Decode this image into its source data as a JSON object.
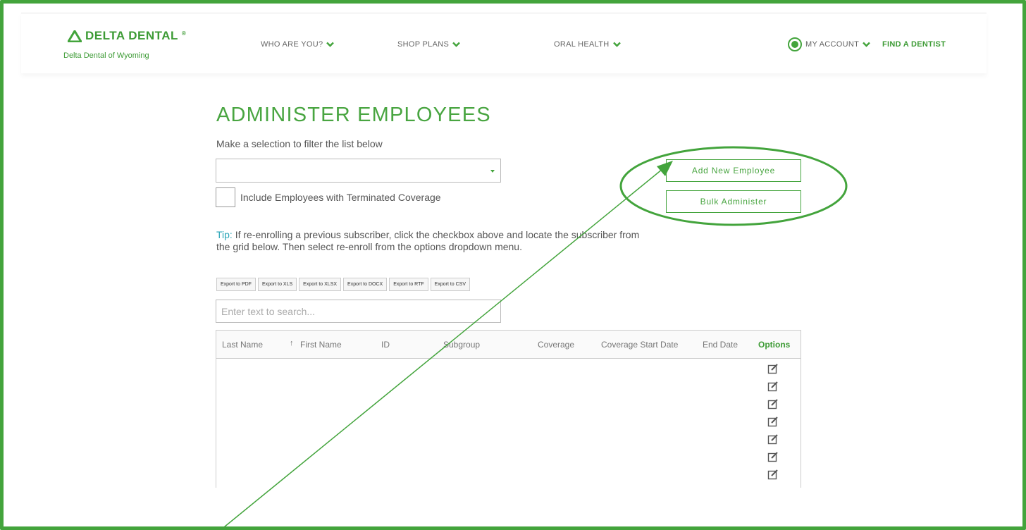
{
  "header": {
    "brand": "DELTA DENTAL",
    "brand_mark": "®",
    "brand_subtitle": "Delta Dental of Wyoming",
    "nav": [
      {
        "label": "WHO ARE YOU?"
      },
      {
        "label": "SHOP PLANS"
      },
      {
        "label": "ORAL HEALTH"
      }
    ],
    "account_label": "MY ACCOUNT",
    "find_dentist": "FIND A DENTIST"
  },
  "page": {
    "title": "ADMINISTER EMPLOYEES",
    "filter_label": "Make a selection to filter the list below",
    "filter_value": "",
    "terminated_label": "Include Employees with Terminated Coverage",
    "add_button": "Add New Employee",
    "bulk_button": "Bulk Administer",
    "tip_word": "Tip:",
    "tip_text": " If re-enrolling a previous subscriber, click the checkbox above and locate the subscriber from the grid below. Then select re-enroll from the options dropdown menu."
  },
  "exports": [
    "Export to PDF",
    "Export to XLS",
    "Export to XLSX",
    "Export to DOCX",
    "Export to RTF",
    "Export to CSV"
  ],
  "search": {
    "placeholder": "Enter text to search...",
    "value": ""
  },
  "grid": {
    "columns": [
      "Last Name",
      "First Name",
      "ID",
      "Subgroup",
      "Coverage",
      "Coverage Start Date",
      "End Date",
      "Options"
    ],
    "sort_indicator": "↑",
    "row_count_visible": 7
  },
  "colors": {
    "brand_green": "#43a43c",
    "tip_blue": "#2ba6b8"
  },
  "icons": [
    "delta-logo-icon",
    "chevron-down-icon",
    "account-icon",
    "edit-icon"
  ]
}
